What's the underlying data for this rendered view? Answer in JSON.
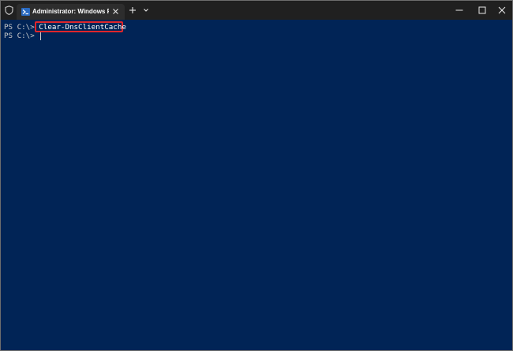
{
  "titlebar": {
    "tab_title": "Administrator: Windows PowerShell",
    "icons": {
      "shield": "shield-icon",
      "tab": "powershell-icon",
      "tab_close": "close-icon",
      "new_tab": "plus-icon",
      "dropdown": "chevron-down-icon",
      "minimize": "minimize-icon",
      "maximize": "maximize-icon",
      "close": "close-icon"
    }
  },
  "console": {
    "lines": [
      {
        "prompt": "PS C:\\> ",
        "command": "Clear-DnsClientCache"
      },
      {
        "prompt": "PS C:\\> ",
        "command": ""
      }
    ]
  },
  "colors": {
    "console_background": "#012456",
    "titlebar_background": "#202020",
    "highlight_border": "#e0262b"
  }
}
